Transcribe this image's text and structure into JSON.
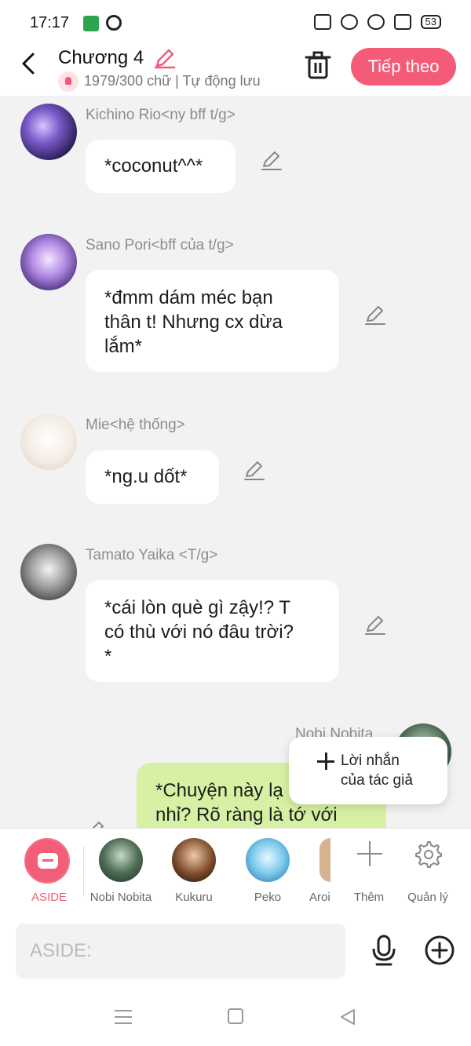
{
  "status": {
    "time": "17:17",
    "battery": "53"
  },
  "header": {
    "title": "Chương 4",
    "subtitle": "1979/300 chữ | Tự động lưu",
    "next_label": "Tiếp theo"
  },
  "messages": [
    {
      "sender": "Kichino Rio<ny bff t/g>",
      "text": "*coconut^^*"
    },
    {
      "sender": "Sano Pori<bff của t/g>",
      "lines": [
        "*đmm dám méc bạn",
        "thân t! Nhưng cx dừa",
        "lắm*"
      ]
    },
    {
      "sender": "Mie<hệ thống>",
      "text": "*ng.u dốt*"
    },
    {
      "sender": "Tamato Yaika <T/g>",
      "lines": [
        "*cái lòn què gì zậy!? T",
        "có thù với nó đâu trời?",
        "*"
      ]
    },
    {
      "sender": "Nobi Nobita",
      "lines": [
        "*Chuyện này lạ",
        "nhỉ? Rõ ràng là tớ với"
      ]
    }
  ],
  "popup": {
    "line1": "Lời nhắn",
    "line2": "của tác giả"
  },
  "characters": {
    "aside": "ASIDE",
    "items": [
      "Nobi Nobita",
      "Kukuru",
      "Peko",
      "Aroi"
    ],
    "add_label": "Thêm",
    "manage_label": "Quản lý"
  },
  "input": {
    "placeholder": "ASIDE:"
  },
  "colors": {
    "accent": "#f45b78",
    "my_bubble": "#d6f1a3",
    "background": "#f2f2f2"
  }
}
